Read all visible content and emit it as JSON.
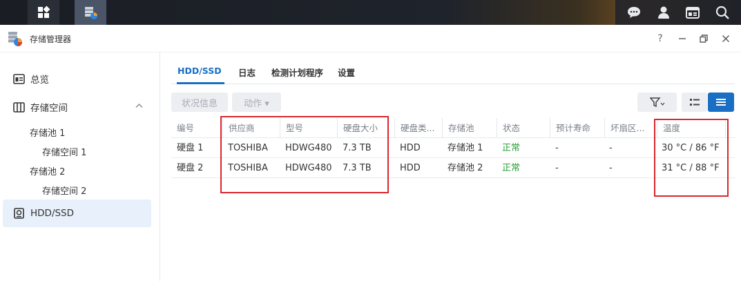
{
  "taskbar": {
    "icons": [
      "main-menu-icon",
      "storage-manager-icon",
      "chat-icon",
      "user-icon",
      "widgets-icon",
      "search-icon"
    ]
  },
  "window": {
    "title": "存储管理器",
    "help": "?",
    "controls": [
      "minimize",
      "restore",
      "close"
    ]
  },
  "sidebar": {
    "overview": "总览",
    "storage": "存储空间",
    "pool1": "存储池 1",
    "vol1": "存储空间 1",
    "pool2": "存储池 2",
    "vol2": "存储空间 2",
    "hdd": "HDD/SSD"
  },
  "tabs": [
    "HDD/SSD",
    "日志",
    "检测计划程序",
    "设置"
  ],
  "toolbar": {
    "status_info": "状况信息",
    "action": "动作 ▾"
  },
  "table": {
    "headers": [
      "编号",
      "供应商",
      "型号",
      "硬盘大小",
      "硬盘类...",
      "存储池",
      "状态",
      "预计寿命",
      "坏扇区...",
      "温度"
    ],
    "rows": [
      [
        "硬盘 1",
        "TOSHIBA",
        "HDWG480",
        "7.3 TB",
        "HDD",
        "存储池 1",
        "正常",
        "-",
        "-",
        "30 °C / 86 °F"
      ],
      [
        "硬盘 2",
        "TOSHIBA",
        "HDWG480",
        "7.3 TB",
        "HDD",
        "存储池 2",
        "正常",
        "-",
        "-",
        "31 °C / 88 °F"
      ]
    ]
  },
  "colors": {
    "accent": "#1a6fc4",
    "status_ok": "#2aa03a",
    "highlight_box": "#d9252b"
  }
}
